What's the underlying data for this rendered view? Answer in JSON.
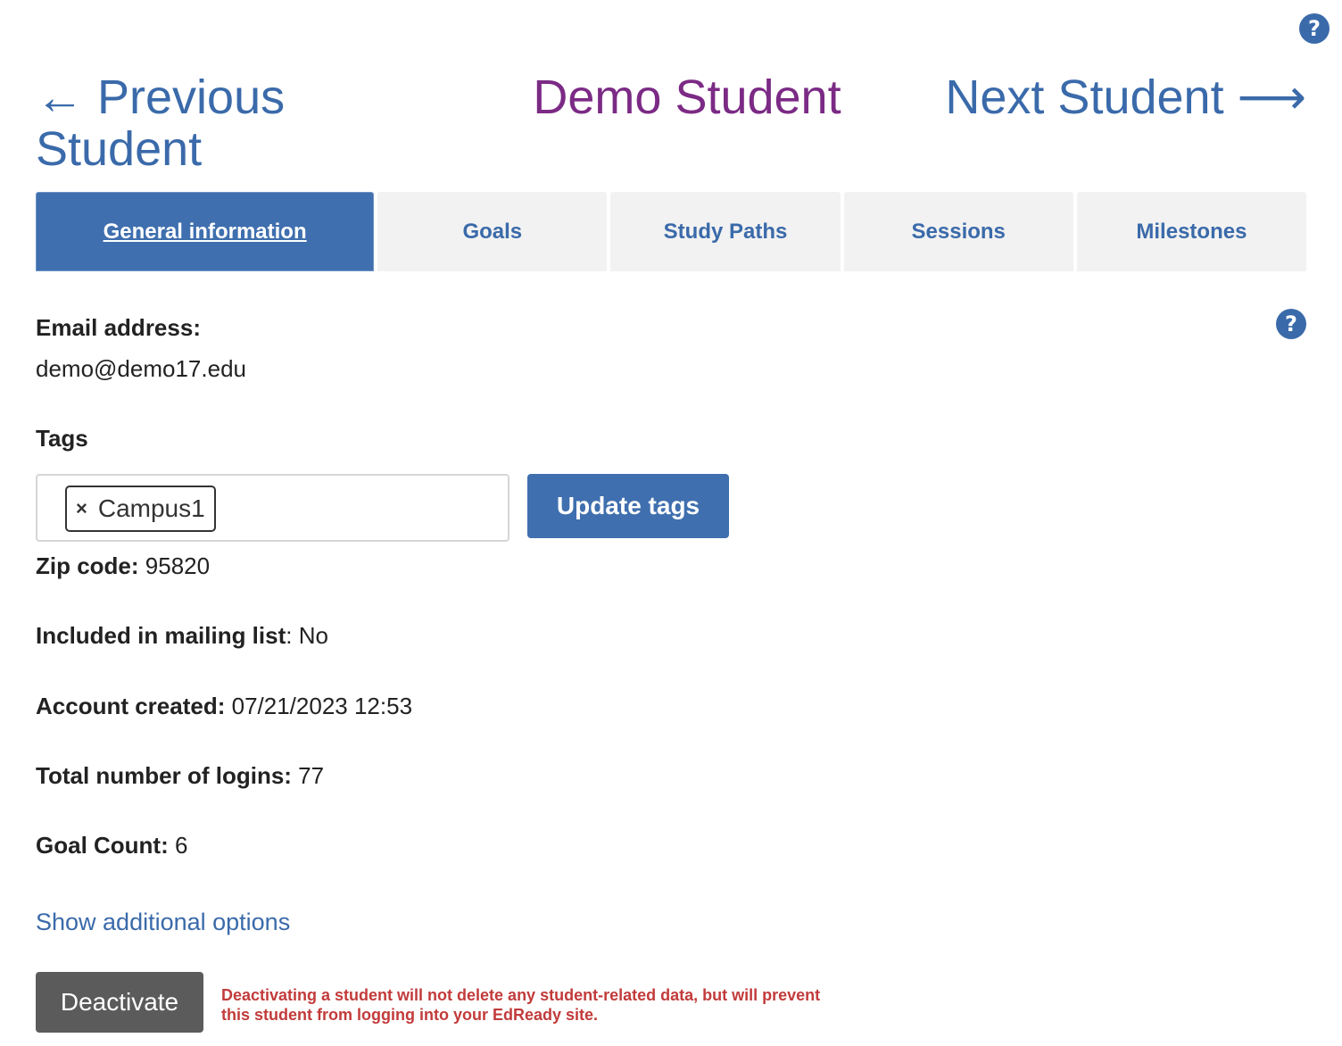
{
  "help": {
    "symbol": "?"
  },
  "nav": {
    "previous": "← Previous Student",
    "student_name": "Demo Student",
    "next": "Next Student ⟶"
  },
  "tabs": [
    {
      "label": "General information",
      "active": true
    },
    {
      "label": "Goals",
      "active": false
    },
    {
      "label": "Study Paths",
      "active": false
    },
    {
      "label": "Sessions",
      "active": false
    },
    {
      "label": "Milestones",
      "active": false
    }
  ],
  "email": {
    "label": "Email address:",
    "value": "demo@demo17.edu"
  },
  "tags": {
    "label": "Tags",
    "items": [
      {
        "remove": "×",
        "text": "Campus1"
      }
    ],
    "update_button": "Update tags"
  },
  "details": {
    "zip": {
      "label": "Zip code:",
      "value": " 95820"
    },
    "mailing": {
      "label": "Included in mailing list",
      "value": ": No"
    },
    "created": {
      "label": "Account created:",
      "value": " 07/21/2023 12:53"
    },
    "logins": {
      "label": "Total number of logins:",
      "value": " 77"
    },
    "goals": {
      "label": "Goal Count:",
      "value": " 6"
    }
  },
  "show_options": "Show additional options",
  "deactivate": {
    "button": "Deactivate",
    "warning": "Deactivating a student will not delete any student-related data, but will prevent this student from logging into your EdReady site."
  },
  "colors": {
    "accent": "#3f6fae",
    "name": "#7b2a85",
    "warning": "#c23b3b"
  }
}
